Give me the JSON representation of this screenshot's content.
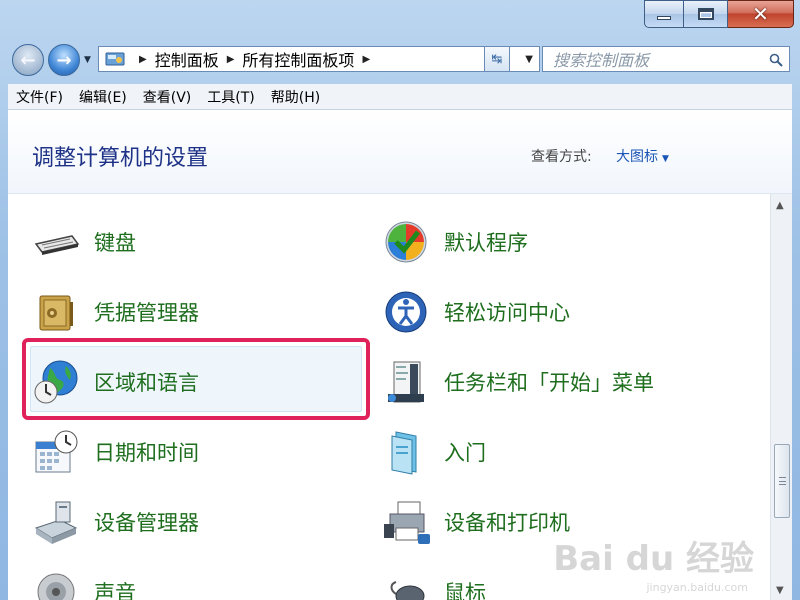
{
  "window": {
    "caption_buttons": [
      "minimize",
      "maximize",
      "close"
    ]
  },
  "nav": {
    "back_icon": "back-arrow-icon",
    "forward_icon": "forward-arrow-icon"
  },
  "address": {
    "crumbs": [
      "控制面板",
      "所有控制面板项"
    ],
    "search_placeholder": "搜索控制面板"
  },
  "menubar": {
    "items": [
      "文件(F)",
      "编辑(E)",
      "查看(V)",
      "工具(T)",
      "帮助(H)"
    ]
  },
  "header": {
    "title": "调整计算机的设置",
    "view_label": "查看方式:",
    "view_value": "大图标"
  },
  "items": [
    {
      "label": "键盘",
      "icon": "keyboard-icon"
    },
    {
      "label": "默认程序",
      "icon": "default-programs-icon"
    },
    {
      "label": "凭据管理器",
      "icon": "credential-manager-icon"
    },
    {
      "label": "轻松访问中心",
      "icon": "ease-of-access-icon"
    },
    {
      "label": "区域和语言",
      "icon": "region-language-icon"
    },
    {
      "label": "任务栏和「开始」菜单",
      "icon": "taskbar-icon"
    },
    {
      "label": "日期和时间",
      "icon": "date-time-icon"
    },
    {
      "label": "入门",
      "icon": "getting-started-icon"
    },
    {
      "label": "设备管理器",
      "icon": "device-manager-icon"
    },
    {
      "label": "设备和打印机",
      "icon": "devices-printers-icon"
    },
    {
      "label": "声音",
      "icon": "sound-icon"
    },
    {
      "label": "鼠标",
      "icon": "mouse-icon"
    }
  ],
  "watermark": {
    "text": "Bai du 经验",
    "sub": "jingyan.baidu.com"
  },
  "colors": {
    "item_label": "#1e6e1e",
    "title": "#1e3287",
    "highlight": "#e0225b",
    "link": "#1a55b5"
  }
}
